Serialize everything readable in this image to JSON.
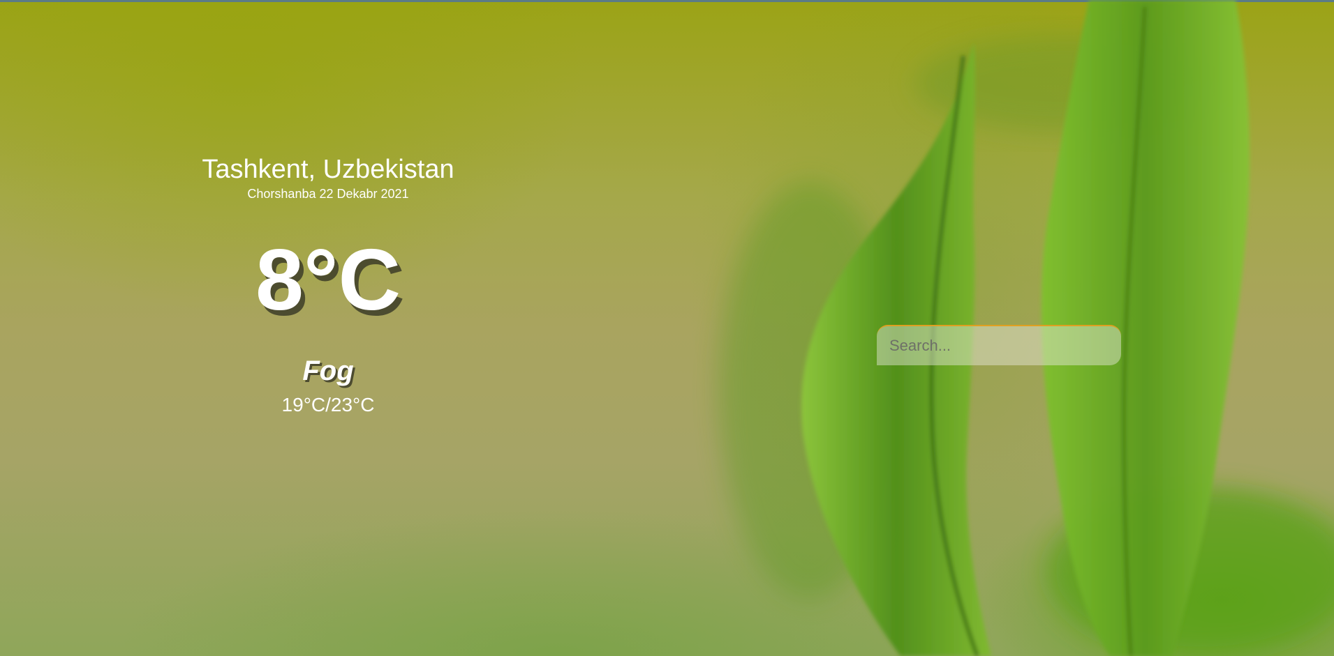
{
  "location": {
    "city": "Tashkent, Uzbekistan",
    "date": "Chorshanba 22 Dekabr 2021"
  },
  "current": {
    "temperature": "8°C",
    "condition": "Fog",
    "range": "19°C/23°C"
  },
  "search": {
    "placeholder": "Search...",
    "value": ""
  },
  "colors": {
    "text": "#ffffff",
    "search_border": "#e0a020",
    "background": "#a6a466",
    "leaf": "#6da51c"
  }
}
